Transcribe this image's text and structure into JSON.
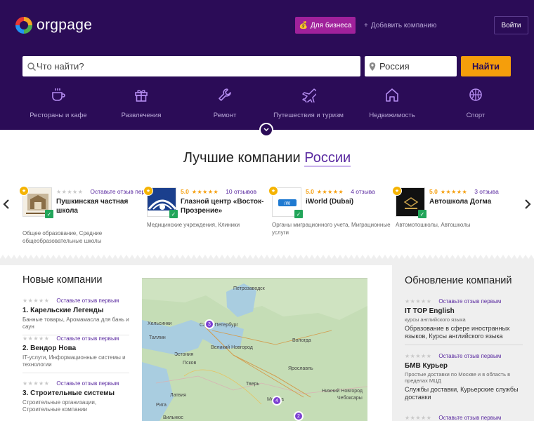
{
  "header": {
    "logo_text": "orgpage",
    "business_button": "Для бизнеса",
    "add_company": "Добавить компанию",
    "login": "Войти"
  },
  "search": {
    "placeholder": "Что найти?",
    "region_value": "Россия",
    "button": "Найти"
  },
  "categories": [
    {
      "label": "Рестораны и кафе",
      "icon": "coffee-cup-icon"
    },
    {
      "label": "Развлечения",
      "icon": "gift-icon"
    },
    {
      "label": "Ремонт",
      "icon": "wrench-icon"
    },
    {
      "label": "Путешествия и туризм",
      "icon": "airplane-icon"
    },
    {
      "label": "Недвижимость",
      "icon": "house-icon"
    },
    {
      "label": "Спорт",
      "icon": "ball-icon"
    }
  ],
  "best": {
    "title_prefix": "Лучшие компании",
    "title_region": "России",
    "cards": [
      {
        "rating": "",
        "reviews": "Оставьте отзыв первым",
        "name": "Пушкинская частная школа",
        "categories": "Общее образование, Средние общеобразовательные школы"
      },
      {
        "rating": "5.0",
        "reviews": "10 отзывов",
        "name": "Глазной центр «Восток-Прозрение»",
        "categories": "Медицинские учреждения, Клиники"
      },
      {
        "rating": "5.0",
        "reviews": "4 отзыва",
        "name": "iWorld (Dubai)",
        "categories": "Органы миграционного учета, Миграционные услуги"
      },
      {
        "rating": "5.0",
        "reviews": "3 отзыва",
        "name": "Автошкола Догма",
        "categories": "Автомотошколы, Автошколы"
      }
    ]
  },
  "new_companies": {
    "title": "Новые компании",
    "items": [
      {
        "review_link": "Оставьте отзыв первым",
        "name": "1. Карельские Легенды",
        "desc": "Банные товары, Аромамасла для бань и саун"
      },
      {
        "review_link": "Оставьте отзыв первым",
        "name": "2. Вендор Нова",
        "desc": "IT-услуги, Информационные системы и технологии"
      },
      {
        "review_link": "Оставьте отзыв первым",
        "name": "3. Строительные системы",
        "desc": "Строительные организации, Строительные компании"
      }
    ]
  },
  "map": {
    "labels": [
      "Петрозаводск",
      "Хельсинки",
      "Санкт-Петербург",
      "Таллин",
      "Великий Новгород",
      "Псков",
      "Вологда",
      "Ярославль",
      "Москва",
      "Тверь",
      "Рига",
      "Вильнюс",
      "Чебоксары",
      "Нижний Новгород",
      "Эстония",
      "Латвия"
    ],
    "pins": [
      "3",
      "4",
      "2"
    ]
  },
  "updates": {
    "title": "Обновление компаний",
    "items": [
      {
        "review_link": "Оставьте отзыв первым",
        "name": "IT TOP English",
        "sub": "курсы английского языка",
        "cats": "Образование в сфере иностранных языков, Курсы английского языка"
      },
      {
        "review_link": "Оставьте отзыв первым",
        "name": "БМВ Курьер",
        "sub": "Простые доставки по Москве и в область в пределах МЦД",
        "cats": "Службы доставки, Курьерские службы доставки"
      },
      {
        "review_link": "Оставьте отзыв первым",
        "name": "",
        "sub": "",
        "cats": ""
      }
    ]
  }
}
